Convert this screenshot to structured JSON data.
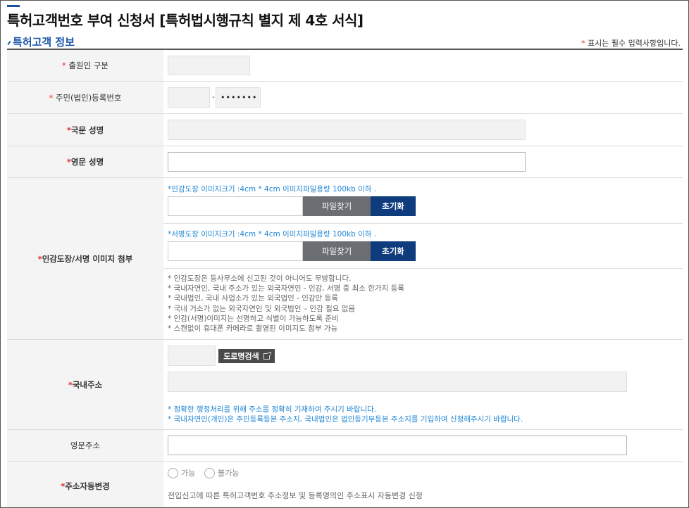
{
  "page": {
    "title": "특허고객번호 부여 신청서 [특허법시행규칙 별지 제 4호 서식]",
    "section_title": "특허고객 정보",
    "required_note": "표시는 필수 입력사항입니다."
  },
  "form": {
    "applicant_type": {
      "label": "출원인 구분"
    },
    "reg_number": {
      "label": "주민(법인)등록번호",
      "separator": "-",
      "masked_value": "•••••••"
    },
    "korean_name": {
      "label": "국문 성명"
    },
    "english_name": {
      "label": "영문 성명"
    },
    "seal": {
      "label": "인감도장/서명 이미지 첨부",
      "seal_hint": "*인감도장 이미지크기 :4cm * 4cm 이미지파일용량 100kb 이하 .",
      "sign_hint": "*서명도장 이미지크기 :4cm * 4cm 이미지파일용량 100kb 이하 .",
      "find_button": "파일찾기",
      "reset_button": "초기화",
      "notes": [
        "* 인감도장은 등사무소에 신고된 것이 아니어도 무방합니다.",
        "* 국내자연인, 국내 주소가 있는 외국자연인 - 인감, 서명 중 최소 한가지 등록",
        "* 국내법인, 국내 사업소가 있는 외국법인 - 인감만 등록",
        "* 국내 거소가 없는 외국자연인 및 외국법인 – 인감 필요 없음",
        "* 인감(서명)이미지는 선명하고 식별이 가능하도록 준비",
        "* 스캔없이 휴대폰 카메라로 촬영된 이미지도 첨부 가능"
      ]
    },
    "domestic_address": {
      "label": "국내주소",
      "road_search_button": "도로명검색",
      "hints": [
        "* 정확한 행정처리를 위해 주소를 정확히 기재하여 주시기 바랍니다.",
        "* 국내자연인(개인)은 주민등록등본 주소지, 국내법인은 법인등기부등본 주소지를 기입하여 신청해주시기 바랍니다."
      ]
    },
    "english_address": {
      "label": "영문주소"
    },
    "auto_address_change": {
      "label": "주소자동변경",
      "option_yes": "가능",
      "option_no": "불가능",
      "description": "전입신고에 따른 특허고객번호 주소정보 및 등록명의인 주소표시 자동변경 신청"
    }
  },
  "colors": {
    "accent": "#1a56a8",
    "required": "#e03030",
    "hint": "#1f86d6",
    "dark_button": "#0f3c7d"
  }
}
